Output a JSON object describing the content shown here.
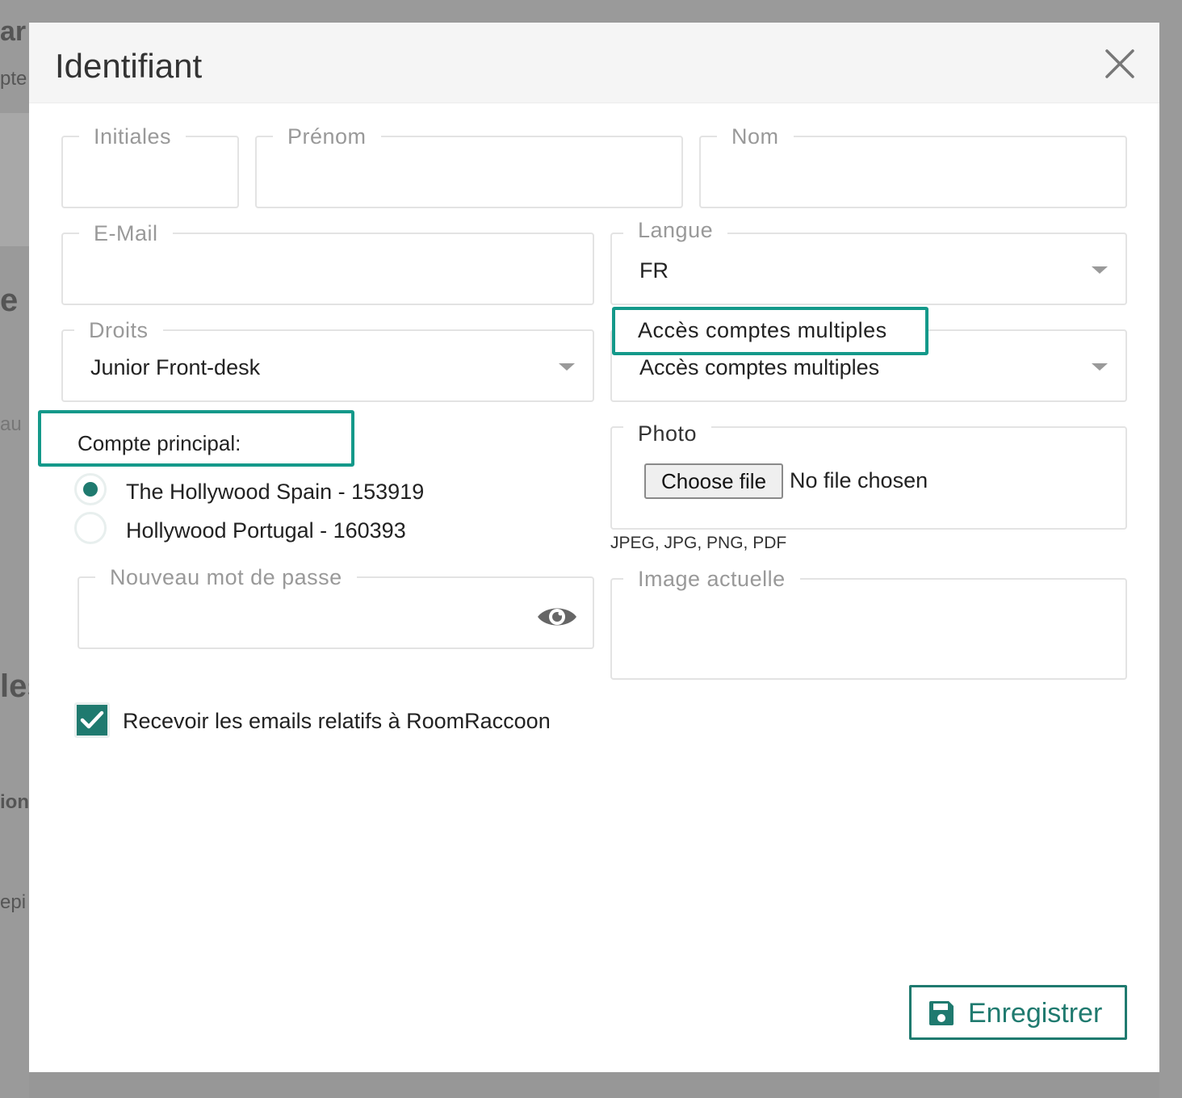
{
  "modal": {
    "title": "Identifiant",
    "close_icon": "close-icon"
  },
  "fields": {
    "initiales": {
      "label": "Initiales",
      "value": ""
    },
    "prenom": {
      "label": "Prénom",
      "value": ""
    },
    "nom": {
      "label": "Nom",
      "value": ""
    },
    "email": {
      "label": "E-Mail",
      "value": ""
    },
    "langue": {
      "label": "Langue",
      "value": "FR"
    },
    "droits": {
      "label": "Droits",
      "value": "Junior Front-desk"
    },
    "acces": {
      "label": "Accès comptes multiples",
      "value": "Accès comptes multiples"
    },
    "password": {
      "label": "Nouveau mot de passe",
      "value": ""
    },
    "image": {
      "label": "Image actuelle",
      "value": ""
    }
  },
  "compte": {
    "label": "Compte principal:",
    "options": [
      {
        "label": "The Hollywood Spain - 153919",
        "checked": true
      },
      {
        "label": "Hollywood Portugal - 160393",
        "checked": false
      }
    ]
  },
  "photo": {
    "label": "Photo",
    "button": "Choose file",
    "status": "No file chosen",
    "hint": "JPEG, JPG, PNG, PDF"
  },
  "emails_checkbox": {
    "label": "Recevoir les emails relatifs à RoomRaccoon",
    "checked": true
  },
  "save": {
    "label": "Enregistrer",
    "icon": "floppy-disk-icon"
  },
  "colors": {
    "accent": "#1f7a6f",
    "highlight": "#14998a"
  }
}
